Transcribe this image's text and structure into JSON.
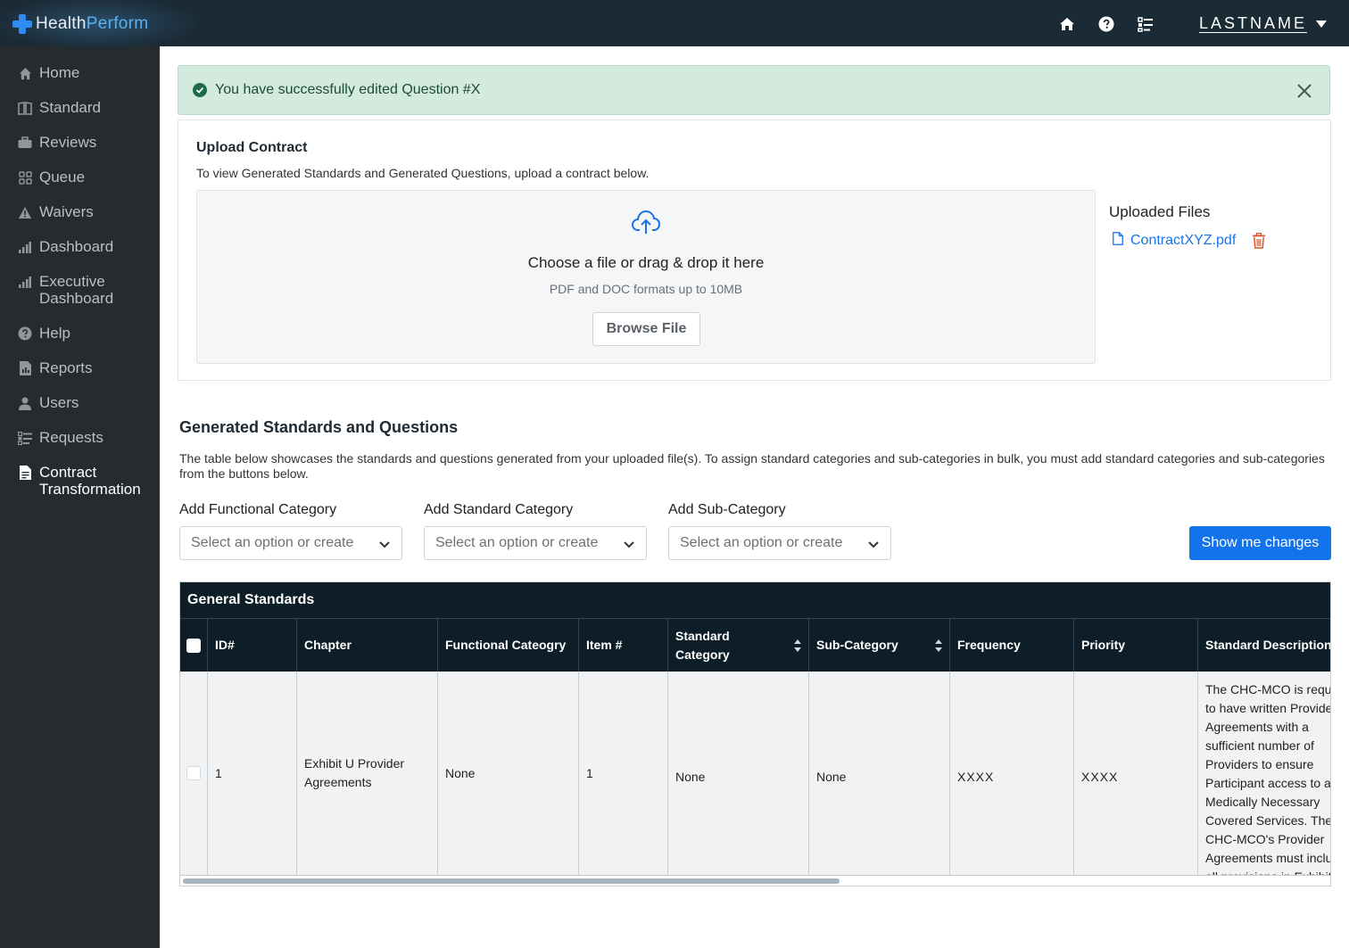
{
  "brand": {
    "name_part1": "Health",
    "name_part2": "Perform"
  },
  "topbar": {
    "icons": [
      "home-icon",
      "help-icon",
      "tasks-icon"
    ],
    "user_label": "LASTNAME"
  },
  "sidebar": {
    "items": [
      {
        "label": "Home",
        "icon": "home-icon"
      },
      {
        "label": "Standard",
        "icon": "book-icon"
      },
      {
        "label": "Reviews",
        "icon": "briefcase-icon"
      },
      {
        "label": "Queue",
        "icon": "grid-icon"
      },
      {
        "label": "Waivers",
        "icon": "warning-icon"
      },
      {
        "label": "Dashboard",
        "icon": "bar-chart-icon"
      },
      {
        "label": "Executive Dashboard",
        "icon": "bar-chart-icon"
      },
      {
        "label": "Help",
        "icon": "help-icon"
      },
      {
        "label": "Reports",
        "icon": "report-icon"
      },
      {
        "label": "Users",
        "icon": "user-icon"
      },
      {
        "label": "Requests",
        "icon": "list-icon"
      },
      {
        "label": "Contract Transformation",
        "icon": "document-icon"
      }
    ],
    "active": "Contract Transformation"
  },
  "alert": {
    "message": "You have successfully edited Question #X"
  },
  "upload": {
    "title": "Upload Contract",
    "subtitle": "To view Generated Standards and Generated Questions, upload a contract below.",
    "drop_text": "Choose a file or drag & drop it here",
    "hint": "PDF and DOC formats up to 10MB",
    "browse_label": "Browse File",
    "uploaded_title": "Uploaded Files",
    "files": [
      {
        "name": "ContractXYZ.pdf"
      }
    ]
  },
  "generated": {
    "title": "Generated Standards and Questions",
    "description": "The table below showcases the standards and questions generated from your uploaded file(s). To assign standard categories and sub-categories in bulk, you must add standard categories and sub-categories from the buttons below.",
    "fields": [
      {
        "label": "Add Functional Category",
        "placeholder": "Select an option or create"
      },
      {
        "label": "Add Standard Category",
        "placeholder": "Select an option or create"
      },
      {
        "label": "Add Sub-Category",
        "placeholder": "Select an option or create"
      }
    ],
    "show_changes_label": "Show me changes"
  },
  "table": {
    "caption": "General Standards",
    "columns": [
      "ID#",
      "Chapter",
      "Functional Cateogry",
      "Item #",
      "Standard Category",
      "Sub-Category",
      "Frequency",
      "Priority",
      "Standard Description"
    ],
    "rows": [
      {
        "id": "1",
        "chapter": "Exhibit U Provider Agreements",
        "functional_category": "None",
        "item": "1",
        "standard_category": "None",
        "sub_category": "None",
        "frequency": "XXXX",
        "priority": "XXXX",
        "description": "The CHC-MCO is required to have written Provider Agreements with a sufficient number of Providers to ensure Participant access to all Medically Necessary Covered Services. The CHC-MCO's Provider Agreements must include all provisions in Exhibit U “Provider Agreements”"
      }
    ]
  },
  "colors": {
    "topbar": "#1b2b36",
    "sidebar": "#262b2f",
    "table_header": "#0d1e29",
    "primary": "#1273eb",
    "alert_bg": "#d3eadf",
    "link": "#1a73e8",
    "trash": "#d9552b"
  }
}
